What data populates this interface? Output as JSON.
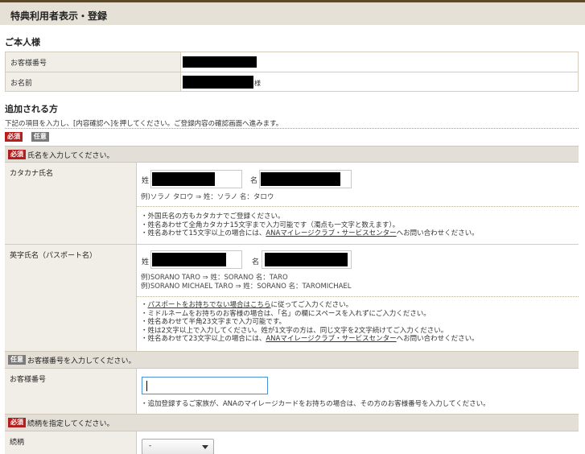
{
  "page": {
    "title": "特典利用者表示・登録"
  },
  "self": {
    "heading": "ご本人様",
    "customer_number_label": "お客様番号",
    "name_label": "お名前",
    "name_suffix": "様"
  },
  "added": {
    "heading": "追加される方",
    "description": "下記の項目を入力し、[内容確認へ]を押してください。ご登録内容の確認画面へ進みます。",
    "legend_required": "必須",
    "legend_optional": "任意"
  },
  "name_section": {
    "badge": "必須",
    "instruction": "氏名を入力してください。",
    "katakana": {
      "label": "カタカナ氏名",
      "last_label": "姓",
      "first_label": "名",
      "example": "例)ソラノ タロウ ⇒ 姓：ソラノ 名：タロウ",
      "notes": [
        "・外国氏名の方もカタカナでご登録ください。",
        "・姓名あわせて全角カタカナ15文字まで入力可能です（濁点も一文字と数えます）。",
        "・姓名あわせて15文字以上の場合には、",
        "ANAマイレージクラブ・サービスセンター",
        "へお問い合わせください。"
      ]
    },
    "english": {
      "label": "英字氏名（パスポート名）",
      "last_label": "姓",
      "first_label": "名",
      "example_1": "例)SORANO TARO ⇒ 姓：SORANO 名：TARO",
      "example_2": "例)SORANO MICHAEL TARO ⇒ 姓：SORANO 名：TAROMICHAEL",
      "note_1_prefix": "・",
      "note_1_link": "パスポートをお持ちでない場合はこちら",
      "note_1_suffix": "に従ってご入力ください。",
      "note_2": "・ミドルネームをお持ちのお客様の場合は、「名」の欄にスペースを入れずにご入力ください。",
      "note_3": "・姓名あわせて半角23文字まで入力可能です。",
      "note_4": "・姓は2文字以上で入力してください。姓が1文字の方は、同じ文字を2文字続けてご入力ください。",
      "note_5_prefix": "・姓名あわせて23文字以上の場合には、",
      "note_5_link": "ANAマイレージクラブ・サービスセンター",
      "note_5_suffix": "へお問い合わせください。"
    }
  },
  "customer_number_section": {
    "badge": "任意",
    "instruction": "お客様番号を入力してください。",
    "label": "お客様番号",
    "value": "",
    "note": "・追加登録するご家族が、ANAのマイレージカードをお持ちの場合は、その方のお客様番号を入力してください。"
  },
  "relation_section": {
    "badge": "必須",
    "instruction": "続柄を指定してください。",
    "label": "続柄",
    "selected": "-"
  },
  "colors": {
    "required_badge": "#b31f1f",
    "optional_badge": "#7a7a7a",
    "band": "#e3dfd6",
    "label_bg": "#f1eee7",
    "focus_border": "#4a8fd8"
  }
}
